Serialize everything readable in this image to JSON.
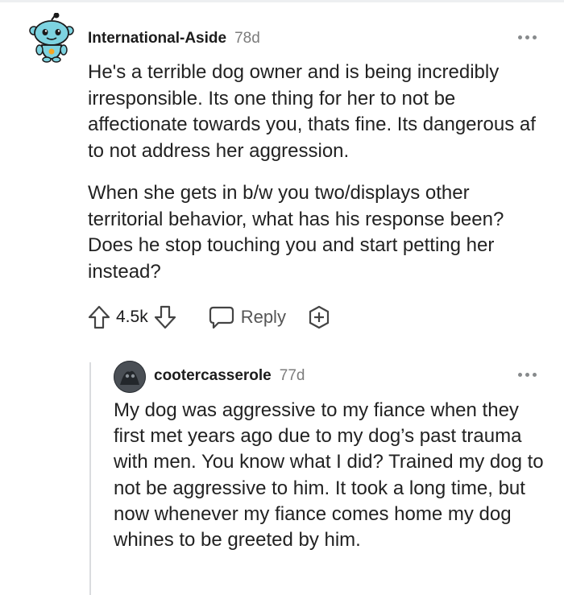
{
  "comment": {
    "username": "International-Aside",
    "age": "78d",
    "paragraphs": [
      "He's a terrible dog owner and is being incredibly irresponsible. Its one thing for her to not be affectionate towards you, thats fine. Its dangerous af to not address her aggression.",
      "When she gets in b/w you two/displays other territorial behavior, what has his response been? Does he stop touching you and start petting her instead?"
    ],
    "score": "4.5k",
    "reply_label": "Reply",
    "avatar_icon": "snoo-avatar-icon",
    "accent_color": "#878a8c"
  },
  "reply": {
    "username": "cootercasserole",
    "age": "77d",
    "text": "My dog was aggressive to my fiance when they first met years ago due to my dog’s past trauma with men. You know what I did? Trained my dog to not be aggressive to him. It took a long time, but now whenever my fiance comes home my dog whines to be greeted by him."
  }
}
